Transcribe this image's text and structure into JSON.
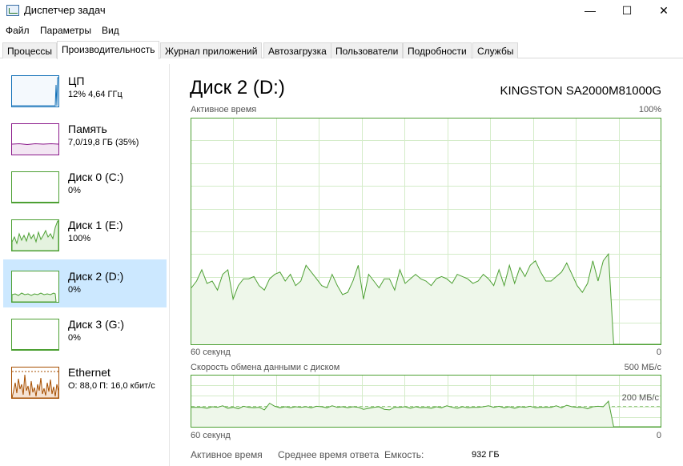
{
  "window": {
    "title": "Диспетчер задач",
    "minimize": "—",
    "maximize": "☐",
    "close": "✕"
  },
  "menu": [
    "Файл",
    "Параметры",
    "Вид"
  ],
  "tabs": [
    "Процессы",
    "Производительность",
    "Журнал приложений",
    "Автозагрузка",
    "Пользователи",
    "Подробности",
    "Службы"
  ],
  "sidebar": [
    {
      "name": "ЦП",
      "sub": "12% 4,64 ГГц",
      "color": "#1170b7"
    },
    {
      "name": "Память",
      "sub": "7,0/19,8 ГБ (35%)",
      "color": "#8b1a8b"
    },
    {
      "name": "Диск 0 (C:)",
      "sub": "0%",
      "color": "#4da033"
    },
    {
      "name": "Диск 1 (E:)",
      "sub": "100%",
      "color": "#4da033"
    },
    {
      "name": "Диск 2 (D:)",
      "sub": "0%",
      "color": "#4da033"
    },
    {
      "name": "Диск 3 (G:)",
      "sub": "0%",
      "color": "#4da033"
    },
    {
      "name": "Ethernet",
      "sub": "О: 88,0 П: 16,0 кбит/с",
      "color": "#a74f01"
    }
  ],
  "main": {
    "title": "Диск 2 (D:)",
    "model": "KINGSTON SA2000M81000G",
    "chart1": {
      "label": "Активное время",
      "max": "100%",
      "xleft": "60 секунд",
      "xright": "0"
    },
    "chart2": {
      "label": "Скорость обмена данными с диском",
      "max": "500 МБ/с",
      "mid": "200 МБ/с",
      "xleft": "60 секунд",
      "xright": "0"
    },
    "stats": {
      "active": "Активное время",
      "response": "Среднее время ответа",
      "capacity_label": "Емкость:",
      "capacity_value": "932 ГБ"
    }
  },
  "chart_data": [
    {
      "type": "area",
      "label": "Активное время",
      "ylim": [
        0,
        100
      ],
      "y_unit": "%",
      "color": "#4da033",
      "values": [
        25,
        28,
        33,
        27,
        28,
        24,
        31,
        33,
        20,
        26,
        29,
        29,
        30,
        26,
        24,
        29,
        31,
        32,
        28,
        31,
        26,
        28,
        35,
        32,
        29,
        26,
        25,
        31,
        26,
        22,
        23,
        28,
        35,
        20,
        31,
        28,
        25,
        29,
        29,
        24,
        33,
        27,
        29,
        31,
        29,
        28,
        26,
        29,
        30,
        29,
        27,
        31,
        30,
        29,
        27,
        28,
        31,
        29,
        26,
        33,
        26,
        35,
        27,
        34,
        30,
        35,
        37,
        32,
        28,
        28,
        30,
        32,
        36,
        31,
        26,
        23,
        27,
        37,
        28,
        37,
        40,
        0,
        0,
        0,
        0,
        0,
        0,
        0,
        0,
        0,
        0
      ]
    },
    {
      "type": "area",
      "label": "Скорость обмена данными с диском",
      "ylim": [
        0,
        500
      ],
      "y_unit": "МБ/с",
      "color": "#4da033",
      "values": [
        190,
        190,
        190,
        180,
        195,
        190,
        205,
        180,
        190,
        175,
        200,
        190,
        185,
        190,
        165,
        230,
        200,
        185,
        195,
        185,
        195,
        190,
        195,
        185,
        200,
        195,
        185,
        205,
        190,
        195,
        185,
        195,
        190,
        170,
        180,
        190,
        195,
        170,
        165,
        190,
        190,
        195,
        180,
        195,
        185,
        190,
        180,
        195,
        185,
        205,
        190,
        180,
        195,
        185,
        190,
        190,
        195,
        205,
        190,
        200,
        185,
        195,
        180,
        195,
        190,
        200,
        185,
        190,
        190,
        190,
        205,
        185,
        210,
        195,
        190,
        190,
        175,
        195,
        200,
        195,
        250,
        0,
        0,
        0,
        0,
        0,
        0,
        0,
        0,
        0,
        0
      ]
    }
  ]
}
